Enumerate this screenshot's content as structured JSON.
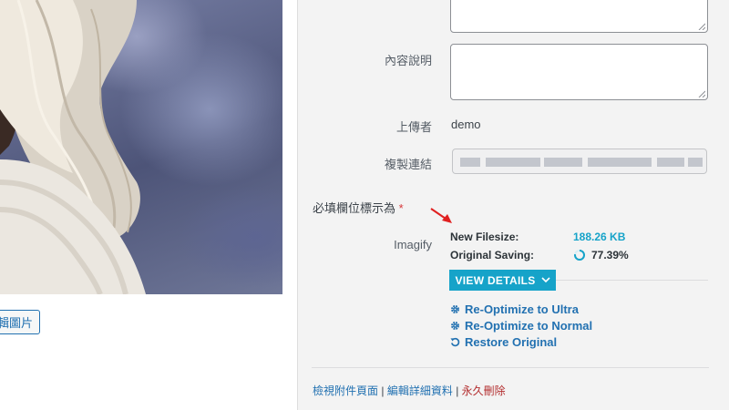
{
  "preview": {
    "edit_button_label": "輯圖片"
  },
  "details": {
    "description_label": "內容說明",
    "uploader_label": "上傳者",
    "uploader_value": "demo",
    "copy_link_label": "複製連結",
    "required_note": "必填欄位標示為",
    "required_star": "*"
  },
  "imagify": {
    "label": "Imagify",
    "new_filesize_label": "New Filesize:",
    "new_filesize_value": "188.26 KB",
    "original_saving_label": "Original Saving:",
    "original_saving_value": "77.39%",
    "original_saving_fraction": 0.7739,
    "view_details_label": "VIEW DETAILS",
    "actions": [
      {
        "label": "Re-Optimize to Ultra",
        "icon": "gear-icon"
      },
      {
        "label": "Re-Optimize to Normal",
        "icon": "gear-icon"
      },
      {
        "label": "Restore Original",
        "icon": "restore-icon"
      }
    ]
  },
  "footer": {
    "view_attachment": "檢視附件頁面",
    "edit_details": "編輯詳細資料",
    "delete_permanently": "永久刪除",
    "separator": "|"
  },
  "colors": {
    "link": "#2271b1",
    "imagify_accent": "#16a3c9",
    "delete": "#b32d2e",
    "required": "#d63638",
    "arrow": "#e02020"
  }
}
